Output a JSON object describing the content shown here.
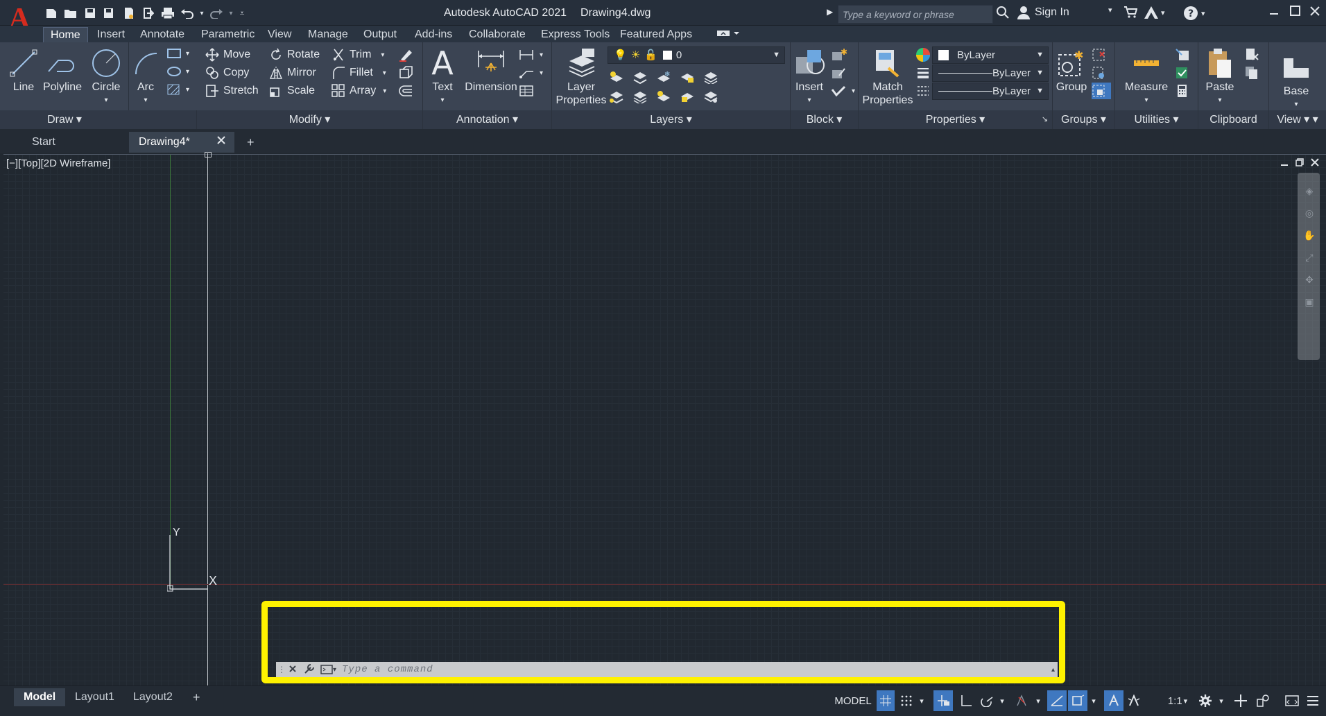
{
  "titlebar": {
    "app_title": "Autodesk AutoCAD 2021",
    "file_name": "Drawing4.dwg",
    "search_placeholder": "Type a keyword or phrase",
    "sign_in": "Sign In"
  },
  "ribbon_tabs": [
    "Home",
    "Insert",
    "Annotate",
    "Parametric",
    "View",
    "Manage",
    "Output",
    "Add-ins",
    "Collaborate",
    "Express Tools",
    "Featured Apps"
  ],
  "draw": {
    "title": "Draw",
    "line": "Line",
    "polyline": "Polyline",
    "circle": "Circle",
    "arc": "Arc"
  },
  "modify": {
    "title": "Modify",
    "move": "Move",
    "rotate": "Rotate",
    "trim": "Trim",
    "copy": "Copy",
    "mirror": "Mirror",
    "fillet": "Fillet",
    "stretch": "Stretch",
    "scale": "Scale",
    "array": "Array"
  },
  "annotation": {
    "title": "Annotation",
    "text": "Text",
    "dimension": "Dimension"
  },
  "layers": {
    "title": "Layers",
    "layer_properties_1": "Layer",
    "layer_properties_2": "Properties",
    "current_layer": "0"
  },
  "block": {
    "title": "Block",
    "insert": "Insert"
  },
  "properties": {
    "title": "Properties",
    "match_1": "Match",
    "match_2": "Properties",
    "color": "ByLayer",
    "linetype": "ByLayer",
    "lineweight": "ByLayer"
  },
  "groups": {
    "title": "Groups",
    "group": "Group"
  },
  "utilities": {
    "title": "Utilities",
    "measure": "Measure"
  },
  "clipboard": {
    "title": "Clipboard",
    "paste": "Paste"
  },
  "view": {
    "title": "View",
    "base": "Base"
  },
  "file_tabs": {
    "start": "Start",
    "drawing": "Drawing4*"
  },
  "viewport": {
    "label": "[−][Top][2D Wireframe]",
    "y_axis": "Y",
    "x_axis": "X"
  },
  "command_line": {
    "placeholder": "Type a command"
  },
  "layout_tabs": {
    "model": "Model",
    "layout1": "Layout1",
    "layout2": "Layout2"
  },
  "status": {
    "mode": "MODEL",
    "scale": "1:1"
  },
  "colors": {
    "highlight": "#fff200",
    "accent": "#3f78c0",
    "background": "#212830"
  }
}
